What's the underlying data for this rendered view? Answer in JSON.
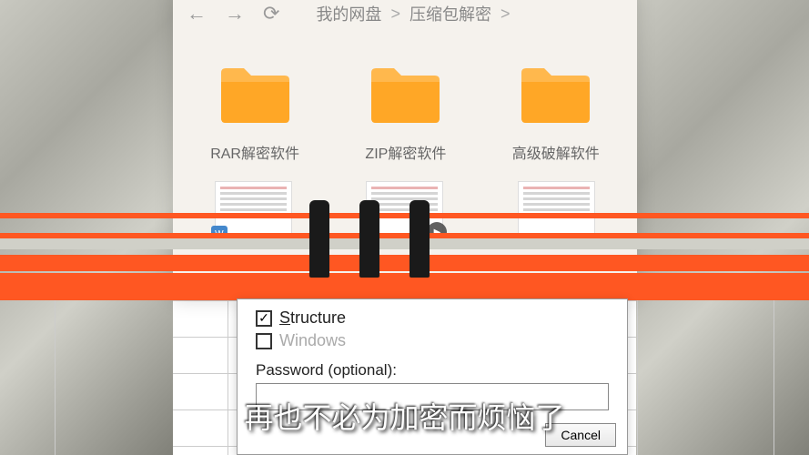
{
  "nav": {
    "breadcrumb": {
      "item1": "我的网盘",
      "item2": "压缩包解密",
      "sep": ">"
    }
  },
  "folders": [
    {
      "name": "RAR解密软件"
    },
    {
      "name": "ZIP解密软件"
    },
    {
      "name": "高级破解软件"
    }
  ],
  "file_badge": "W",
  "dialog": {
    "structure_label": "Structure",
    "windows_label": "Windows",
    "structure_checked": true,
    "windows_checked": false,
    "password_label": "Password (optional):",
    "password_value": "",
    "cancel_label": "Cancel"
  },
  "subtitle": "再也不必为加密而烦恼了"
}
